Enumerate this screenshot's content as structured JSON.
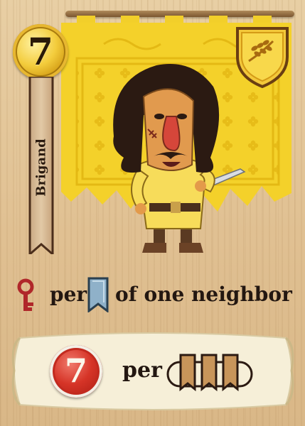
{
  "card": {
    "cost": "7",
    "name": "Brigand",
    "ability": {
      "per_word": "per",
      "tail_text": "of one neighbor",
      "reward_value": "7",
      "reward_per_word": "per"
    },
    "icons": {
      "coin": "gold-coin-icon",
      "shield": "wheat-shield-icon",
      "key": "key-icon",
      "banner": "blue-banner-icon",
      "token": "red-seal-token-icon",
      "cards": "three-brown-cards-icon"
    },
    "colors": {
      "tapestry": "#f4d12a",
      "gold": "#f3cc3c",
      "red": "#d63427",
      "banner_blue": "#8fb1c9"
    }
  }
}
